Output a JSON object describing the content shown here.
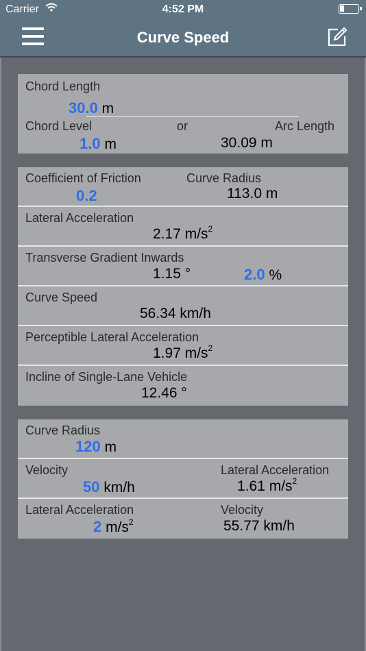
{
  "status_bar": {
    "carrier": "Carrier",
    "time": "4:52 PM"
  },
  "nav": {
    "title": "Curve Speed"
  },
  "chord": {
    "chord_length_label": "Chord Length",
    "chord_length_value": "30.0",
    "chord_length_unit": "m",
    "chord_level_label": "Chord Level",
    "or_label": "or",
    "arc_length_label": "Arc Length",
    "chord_level_value": "1.0",
    "chord_level_unit": "m",
    "arc_length_value": "30.09 m"
  },
  "friction": {
    "cof_label": "Coefficient of Friction",
    "cof_value": "0.2",
    "curve_radius_label": "Curve Radius",
    "curve_radius_value": "113.0 m",
    "lat_acc_label": "Lateral Acceleration",
    "lat_acc_value": "2.17 m/s",
    "lat_acc_exp": "2",
    "gradient_label": "Transverse Gradient Inwards",
    "gradient_deg_value": "1.15 °",
    "gradient_pct_value": "2.0",
    "gradient_pct_unit": "%",
    "curve_speed_label": "Curve Speed",
    "curve_speed_value": "56.34 km/h",
    "perc_lat_acc_label": "Perceptible Lateral Acceleration",
    "perc_lat_acc_value": "1.97 m/s",
    "perc_lat_acc_exp": "2",
    "incline_label": "Incline of Single-Lane Vehicle",
    "incline_value": "12.46 °"
  },
  "radius_calc": {
    "curve_radius_label": "Curve Radius",
    "curve_radius_value": "120",
    "curve_radius_unit": "m",
    "velocity_label": "Velocity",
    "velocity_value": "50",
    "velocity_unit": "km/h",
    "lat_acc_label": "Lateral Acceleration",
    "lat_acc_result": "1.61 m/s",
    "lat_acc_result_exp": "2",
    "lat_acc_input_label": "Lateral Acceleration",
    "lat_acc_input_value": "2",
    "lat_acc_input_unit": "m/s",
    "lat_acc_input_exp": "2",
    "velocity_result_label": "Velocity",
    "velocity_result_value": "55.77 km/h"
  },
  "colors": {
    "nav_bg": "#5e7482",
    "page_bg": "#65686f",
    "card_bg": "#a7a8ab",
    "input_blue": "#2f6fe6"
  },
  "icons": {
    "menu": "hamburger-icon",
    "edit": "edit-icon",
    "wifi": "wifi-icon",
    "battery": "battery-icon"
  }
}
